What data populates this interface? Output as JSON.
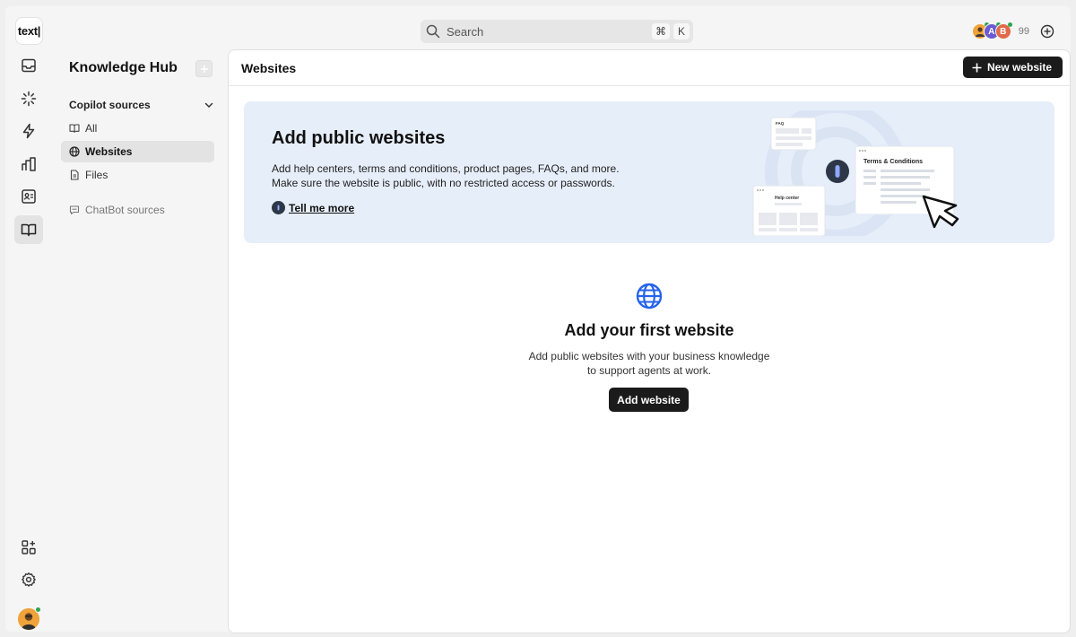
{
  "app": {
    "logo_text": "text|"
  },
  "search": {
    "placeholder": "Search",
    "shortcut_cmd": "⌘",
    "shortcut_key": "K"
  },
  "topbar": {
    "avatars": [
      {
        "initial": "",
        "color": "#f0a33a"
      },
      {
        "initial": "A",
        "color": "#6b5bd2"
      },
      {
        "initial": "B",
        "color": "#e06a4a"
      }
    ],
    "avatar_count": "99"
  },
  "rail": {
    "items": [
      {
        "name": "inbox-icon"
      },
      {
        "name": "sparkle-icon"
      },
      {
        "name": "bolt-icon"
      },
      {
        "name": "reports-icon"
      },
      {
        "name": "contacts-icon"
      },
      {
        "name": "knowledge-book-icon",
        "active": true
      }
    ],
    "bottom": [
      {
        "name": "apps-icon"
      },
      {
        "name": "settings-icon"
      }
    ]
  },
  "sidebar": {
    "title": "Knowledge Hub",
    "section_title": "Copilot sources",
    "items": [
      {
        "label": "All",
        "icon": "book-icon"
      },
      {
        "label": "Websites",
        "icon": "globe-icon",
        "active": true
      },
      {
        "label": "Files",
        "icon": "file-icon"
      }
    ],
    "chatbot_label": "ChatBot sources"
  },
  "main": {
    "title": "Websites",
    "new_button_label": "New website",
    "banner": {
      "title": "Add public websites",
      "text_line1": "Add help centers, terms and conditions, product pages, FAQs, and more.",
      "text_line2": "Make sure the website is public, with no restricted access or passwords.",
      "link_label": "Tell me more",
      "illustration": {
        "faq": "FAQ",
        "help": "Help center",
        "terms": "Terms & Conditions"
      }
    },
    "empty": {
      "title": "Add your first website",
      "text_line1": "Add public websites with your business knowledge",
      "text_line2": "to support agents at work.",
      "button_label": "Add website"
    }
  },
  "colors": {
    "accent_blue": "#2563eb",
    "banner_bg": "#e6eef9",
    "dark_button": "#1b1b1b"
  }
}
